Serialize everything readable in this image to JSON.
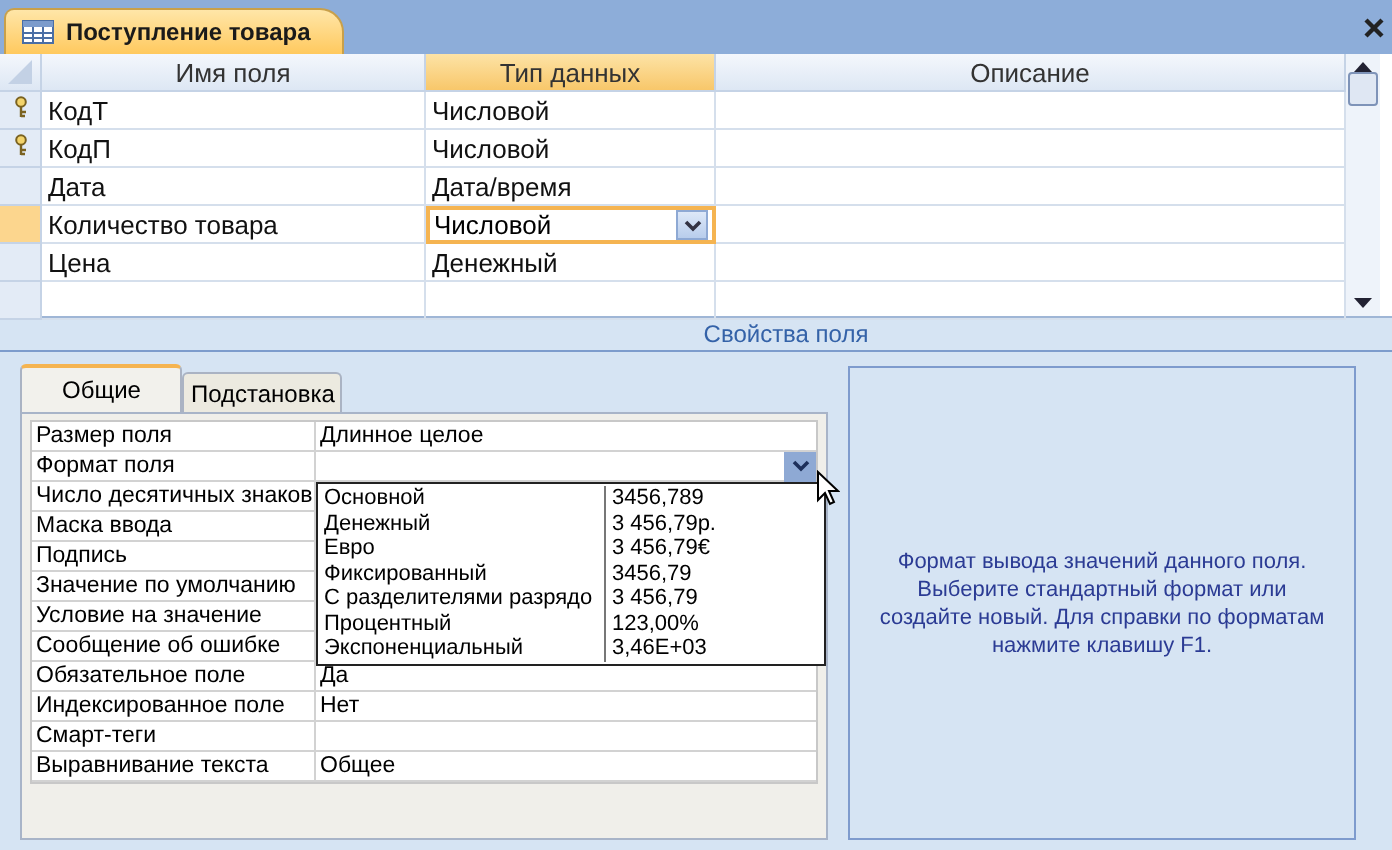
{
  "document_tab": {
    "title": "Поступление товара"
  },
  "design_grid": {
    "columns": [
      "Имя поля",
      "Тип данных",
      "Описание"
    ],
    "rows": [
      {
        "name": "КодТ",
        "type": "Числовой",
        "primary_key": true,
        "selected": false
      },
      {
        "name": "КодП",
        "type": "Числовой",
        "primary_key": true,
        "selected": false
      },
      {
        "name": "Дата",
        "type": "Дата/время",
        "primary_key": false,
        "selected": false
      },
      {
        "name": "Количество товара",
        "type": "Числовой",
        "primary_key": false,
        "selected": true
      },
      {
        "name": "Цена",
        "type": "Денежный",
        "primary_key": false,
        "selected": false
      }
    ]
  },
  "properties_header": "Свойства поля",
  "property_tabs": [
    {
      "label": "Общие",
      "selected": true
    },
    {
      "label": "Подстановка",
      "selected": false
    }
  ],
  "properties": [
    {
      "label": "Размер поля",
      "value": "Длинное целое"
    },
    {
      "label": "Формат поля",
      "dropdown": true
    },
    {
      "label": "Число десятичных знаков"
    },
    {
      "label": "Маска ввода"
    },
    {
      "label": "Подпись"
    },
    {
      "label": "Значение по умолчанию"
    },
    {
      "label": "Условие на значение"
    },
    {
      "label": "Сообщение об ошибке"
    },
    {
      "label": "Обязательное поле",
      "value": "Да"
    },
    {
      "label": "Индексированное поле",
      "value": "Нет"
    },
    {
      "label": "Смарт-теги"
    },
    {
      "label": "Выравнивание текста",
      "value": "Общее"
    }
  ],
  "format_list": [
    {
      "name": "Основной",
      "example": "3456,789"
    },
    {
      "name": "Денежный",
      "example": "3 456,79р."
    },
    {
      "name": "Евро",
      "example": "3 456,79€"
    },
    {
      "name": "Фиксированный",
      "example": "3456,79"
    },
    {
      "name": "С разделителями разрядо",
      "example": "3 456,79"
    },
    {
      "name": "Процентный",
      "example": "123,00%"
    },
    {
      "name": "Экспоненциальный",
      "example": "3,46E+03"
    }
  ],
  "help_text": "Формат вывода значений данного поля. Выберите стандартный формат или создайте новый.  Для справки по форматам нажмите клавишу F1."
}
